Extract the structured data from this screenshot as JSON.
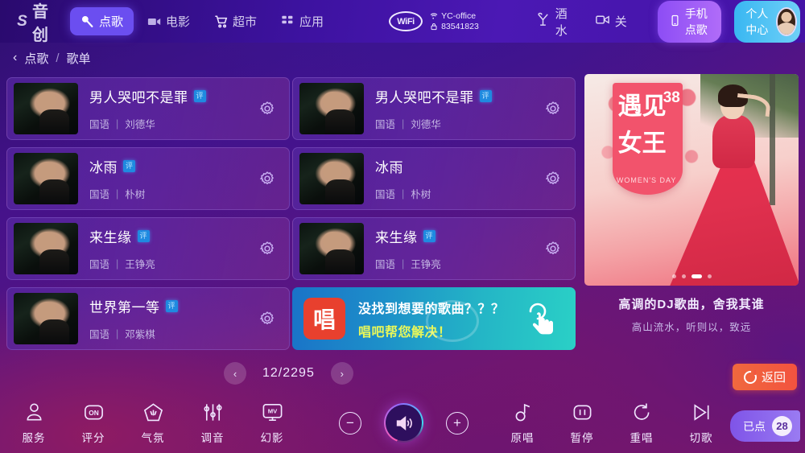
{
  "header": {
    "logo_text": "音创",
    "logo_mark": "S",
    "nav": [
      {
        "label": "点歌",
        "icon": "mic-icon",
        "active": true
      },
      {
        "label": "电影",
        "icon": "film-icon",
        "active": false
      },
      {
        "label": "超市",
        "icon": "cart-icon",
        "active": false
      },
      {
        "label": "应用",
        "icon": "grid-icon",
        "active": false
      }
    ],
    "wifi_label": "WiFi",
    "wifi_ssid": "YC-office",
    "wifi_password": "83541823",
    "drinks_label": "酒水",
    "close_label": "关",
    "phone_order_label": "手机点歌",
    "user_center_label": "个人中心"
  },
  "breadcrumb": {
    "back": "‹",
    "parent": "点歌",
    "separator": "/",
    "current": "歌单"
  },
  "songs_left": [
    {
      "title": "男人哭吧不是罪",
      "badge": "评",
      "lang": "国语",
      "artist": "刘德华"
    },
    {
      "title": "冰雨",
      "badge": "评",
      "lang": "国语",
      "artist": "朴树"
    },
    {
      "title": "来生缘",
      "badge": "评",
      "lang": "国语",
      "artist": "王铮亮"
    },
    {
      "title": "世界第一等",
      "badge": "评",
      "lang": "国语",
      "artist": "邓紫棋"
    }
  ],
  "songs_right": [
    {
      "title": "男人哭吧不是罪",
      "badge": "评",
      "lang": "国语",
      "artist": "刘德华"
    },
    {
      "title": "冰雨",
      "badge": "",
      "lang": "国语",
      "artist": "朴树"
    },
    {
      "title": "来生缘",
      "badge": "评",
      "lang": "国语",
      "artist": "王铮亮"
    }
  ],
  "promo": {
    "logo": "唱",
    "line1": "没找到想要的歌曲？？？",
    "line2": "唱吧帮您解决！"
  },
  "poster": {
    "tag_top": "遇见",
    "tag_num": "38",
    "tag_bottom": "女王",
    "tag_en": "WOMEN'S DAY",
    "caption_title": "高调的DJ歌曲，舍我其谁",
    "caption_sub": "高山流水，听则以，致远",
    "dots_total": 4,
    "dots_active": 3
  },
  "pager": {
    "prev": "‹",
    "next": "›",
    "position": "12/2295"
  },
  "back_button": {
    "label": "返回",
    "icon": "return-icon"
  },
  "bottom_bar": {
    "left_tools": [
      {
        "label": "服务",
        "icon": "service-person-icon"
      },
      {
        "label": "评分",
        "icon": "on-score-icon"
      },
      {
        "label": "气氛",
        "icon": "atmosphere-icon"
      },
      {
        "label": "调音",
        "icon": "equalizer-icon"
      },
      {
        "label": "幻影",
        "icon": "mv-screen-icon"
      }
    ],
    "volume": {
      "minus": "−",
      "plus": "+",
      "icon": "speaker-icon"
    },
    "right_tools": [
      {
        "label": "原唱",
        "icon": "original-vocal-icon"
      },
      {
        "label": "暂停",
        "icon": "pause-icon"
      },
      {
        "label": "重唱",
        "icon": "replay-icon"
      },
      {
        "label": "切歌",
        "icon": "next-track-icon"
      }
    ],
    "ordered": {
      "label": "已点",
      "count": "28"
    }
  },
  "colors": {
    "accent_purple": "#6b4ef0",
    "promo_cyan": "#2ad0c6",
    "badge_blue": "#1f8ae0",
    "back_orange": "#f2533f",
    "poster_red": "#f2536c"
  }
}
